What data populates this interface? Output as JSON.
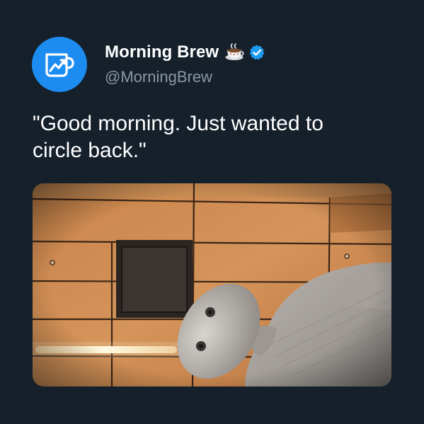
{
  "tweet": {
    "author": {
      "display_name": "Morning Brew",
      "handle": "@MorningBrew",
      "avatar_icon": "coffee-mug-chart-icon",
      "avatar_color": "#1d8cf0",
      "name_emoji_icon": "coffee-cup-emoji-icon",
      "verified_icon": "verified-badge-icon",
      "verified_color": "#1d9bf0"
    },
    "text": "\"Good morning. Just wanted to\ncircle back.\"",
    "media": {
      "type": "image",
      "subject_icon": "mannequin-figure"
    }
  },
  "colors": {
    "background": "#15202b",
    "text_primary": "#ffffff",
    "text_secondary": "#8b98a5"
  }
}
